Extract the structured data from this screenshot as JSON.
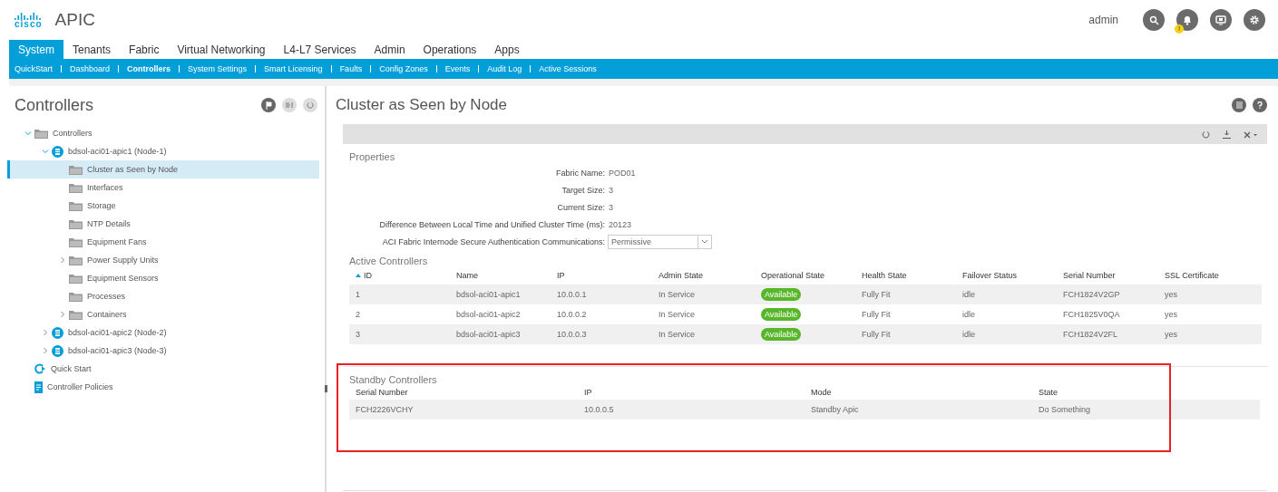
{
  "header": {
    "logo_word": "cisco",
    "app_name": "APIC",
    "user": "admin",
    "notification_badge": "!"
  },
  "main_tabs": [
    {
      "label": "System",
      "selected": true
    },
    {
      "label": "Tenants",
      "selected": false
    },
    {
      "label": "Fabric",
      "selected": false
    },
    {
      "label": "Virtual Networking",
      "selected": false
    },
    {
      "label": "L4-L7 Services",
      "selected": false
    },
    {
      "label": "Admin",
      "selected": false
    },
    {
      "label": "Operations",
      "selected": false
    },
    {
      "label": "Apps",
      "selected": false
    }
  ],
  "sub_tabs": [
    {
      "label": "QuickStart",
      "selected": false
    },
    {
      "label": "Dashboard",
      "selected": false
    },
    {
      "label": "Controllers",
      "selected": true
    },
    {
      "label": "System Settings",
      "selected": false
    },
    {
      "label": "Smart Licensing",
      "selected": false
    },
    {
      "label": "Faults",
      "selected": false
    },
    {
      "label": "Config Zones",
      "selected": false
    },
    {
      "label": "Events",
      "selected": false
    },
    {
      "label": "Audit Log",
      "selected": false
    },
    {
      "label": "Active Sessions",
      "selected": false
    }
  ],
  "sidebar": {
    "title": "Controllers",
    "tree": [
      {
        "label": "Controllers",
        "kind": "folder",
        "expanded": true,
        "selected": false,
        "children": [
          {
            "label": "bdsol-aci01-apic1 (Node-1)",
            "kind": "server",
            "expanded": true,
            "selected": false,
            "children": [
              {
                "label": "Cluster as Seen by Node",
                "kind": "folder",
                "selected": true
              },
              {
                "label": "Interfaces",
                "kind": "folder",
                "selected": false
              },
              {
                "label": "Storage",
                "kind": "folder",
                "selected": false
              },
              {
                "label": "NTP Details",
                "kind": "folder",
                "selected": false
              },
              {
                "label": "Equipment Fans",
                "kind": "folder",
                "selected": false
              },
              {
                "label": "Power Supply Units",
                "kind": "folder",
                "expanded": false,
                "selected": false
              },
              {
                "label": "Equipment Sensors",
                "kind": "folder",
                "selected": false
              },
              {
                "label": "Processes",
                "kind": "folder",
                "selected": false
              },
              {
                "label": "Containers",
                "kind": "folder",
                "expanded": false,
                "selected": false
              }
            ]
          },
          {
            "label": "bdsol-aci01-apic2 (Node-2)",
            "kind": "server",
            "expanded": false,
            "selected": false
          },
          {
            "label": "bdsol-aci01-apic3 (Node-3)",
            "kind": "server",
            "expanded": false,
            "selected": false
          }
        ]
      },
      {
        "label": "Quick Start",
        "kind": "quickstart",
        "selected": false
      },
      {
        "label": "Controller Policies",
        "kind": "policy",
        "selected": false
      }
    ]
  },
  "content": {
    "title": "Cluster as Seen by Node",
    "properties": {
      "heading": "Properties",
      "rows": [
        {
          "label": "Fabric Name:",
          "value": "POD01",
          "kind": "text"
        },
        {
          "label": "Target Size:",
          "value": "3",
          "kind": "text"
        },
        {
          "label": "Current Size:",
          "value": "3",
          "kind": "text"
        },
        {
          "label": "Difference Between Local Time and Unified Cluster Time (ms):",
          "value": "20123",
          "kind": "text"
        },
        {
          "label": "ACI Fabric Internode Secure Authentication Communications:",
          "value": "Permissive",
          "kind": "select"
        }
      ]
    },
    "active_controllers": {
      "heading": "Active Controllers",
      "columns": [
        {
          "label": "ID",
          "sorted": true
        },
        {
          "label": "Name",
          "sorted": false
        },
        {
          "label": "IP",
          "sorted": false
        },
        {
          "label": "Admin State",
          "sorted": false
        },
        {
          "label": "Operational State",
          "sorted": false
        },
        {
          "label": "Health State",
          "sorted": false
        },
        {
          "label": "Failover Status",
          "sorted": false
        },
        {
          "label": "Serial Number",
          "sorted": false
        },
        {
          "label": "SSL Certificate",
          "sorted": false
        }
      ],
      "rows": [
        [
          "1",
          "bdsol-aci01-apic1",
          "10.0.0.1",
          "In Service",
          "Available",
          "Fully Fit",
          "idle",
          "FCH1824V2GP",
          "yes"
        ],
        [
          "2",
          "bdsol-aci01-apic2",
          "10.0.0.2",
          "In Service",
          "Available",
          "Fully Fit",
          "idle",
          "FCH1825V0QA",
          "yes"
        ],
        [
          "3",
          "bdsol-aci01-apic3",
          "10.0.0.3",
          "In Service",
          "Available",
          "Fully Fit",
          "idle",
          "FCH1824V2FL",
          "yes"
        ]
      ]
    },
    "standby_controllers": {
      "heading": "Standby Controllers",
      "highlighted": true,
      "columns": [
        "Serial Number",
        "IP",
        "Mode",
        "State"
      ],
      "rows": [
        [
          "FCH2226VCHY",
          "10.0.0.5",
          "Standby Apic",
          "Do Something"
        ]
      ]
    }
  }
}
